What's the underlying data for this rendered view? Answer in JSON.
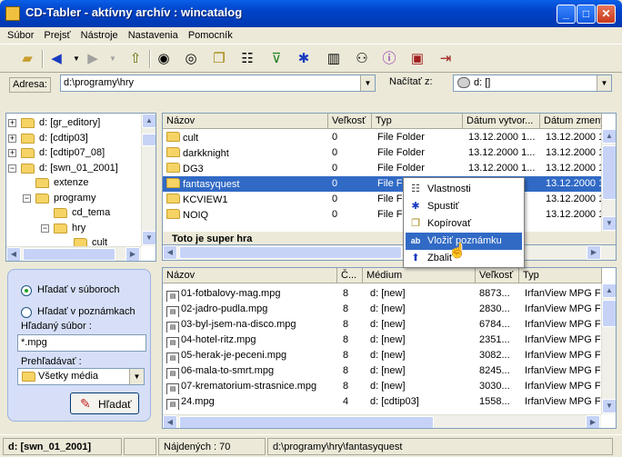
{
  "window": {
    "title": "CD-Tabler  - aktívny archív  : wincatalog",
    "minimize": "_",
    "maximize": "□",
    "close": "✕"
  },
  "menu": [
    "Súbor",
    "Prejsť",
    "Nástroje",
    "Nastavenia",
    "Pomocník"
  ],
  "toolbar_icons": [
    "open-folder-icon",
    "back-icon",
    "dropdown-icon",
    "forward-icon",
    "dropdown-icon",
    "up-folder-icon",
    "binoculars-icon",
    "binoculars-multi-icon",
    "copy-icon",
    "properties-icon",
    "filter-icon",
    "run-icon",
    "delete-icon",
    "network-icon",
    "info-icon",
    "book-icon",
    "exit-icon"
  ],
  "address": {
    "label": "Adresa:",
    "value": "d:\\programy\\hry",
    "load_label": "Načítať z:",
    "load_value": "d: []"
  },
  "tree": {
    "items": [
      {
        "label": "d: [gr_editory]",
        "level": 0,
        "exp": "+"
      },
      {
        "label": "d: [cdtip03]",
        "level": 0,
        "exp": "+"
      },
      {
        "label": "d: [cdtip07_08]",
        "level": 0,
        "exp": "+"
      },
      {
        "label": "d: [swn_01_2001]",
        "level": 0,
        "exp": "-"
      },
      {
        "label": "extenze",
        "level": 1,
        "exp": ""
      },
      {
        "label": "programy",
        "level": 1,
        "exp": "-"
      },
      {
        "label": "cd_tema",
        "level": 2,
        "exp": ""
      },
      {
        "label": "hry",
        "level": 2,
        "exp": "-"
      },
      {
        "label": "cult",
        "level": 3,
        "exp": ""
      }
    ]
  },
  "folders": {
    "headers": [
      "Názov",
      "Veľkosť",
      "Typ",
      "Dátum vytvor...",
      "Dátum zmeny"
    ],
    "rows": [
      {
        "name": "cult",
        "size": "0",
        "type": "File Folder",
        "created": "13.12.2000 1...",
        "modified": "13.12.2000 1...",
        "selected": false
      },
      {
        "name": "darkknight",
        "size": "0",
        "type": "File Folder",
        "created": "13.12.2000 1...",
        "modified": "13.12.2000 1...",
        "selected": false
      },
      {
        "name": "DG3",
        "size": "0",
        "type": "File Folder",
        "created": "13.12.2000 1...",
        "modified": "13.12.2000 1...",
        "selected": false
      },
      {
        "name": "fantasyquest",
        "size": "0",
        "type": "File Fo",
        "created": "",
        "modified": "13.12.2000 1...",
        "selected": true
      },
      {
        "name": "KCVIEW1",
        "size": "0",
        "type": "File Fo",
        "created": "",
        "modified": "13.12.2000 1...",
        "selected": false
      },
      {
        "name": "NOIQ",
        "size": "0",
        "type": "File Fo",
        "created": "",
        "modified": "13.12.2000 1...",
        "selected": false
      }
    ],
    "note": "Toto je super hra"
  },
  "context_menu": [
    {
      "label": "Vlastnosti",
      "icon": "properties-icon"
    },
    {
      "label": "Spustiť",
      "icon": "run-icon"
    },
    {
      "label": "Kopírovať",
      "icon": "copy-icon"
    },
    {
      "label": "Vložiť poznámku",
      "icon": "note-icon"
    },
    {
      "label": "Zbaliť",
      "icon": "collapse-up-icon"
    }
  ],
  "search": {
    "radio_files": "Hľadať v súboroch",
    "radio_notes": "Hľadať v poznámkach",
    "file_label": "Hľadaný súbor :",
    "file_value": "*.mpg",
    "browse_label": "Prehľadávať :",
    "browse_value": "Všetky média",
    "search_button": "Hľadať"
  },
  "results": {
    "headers": [
      "Názov",
      "Č...",
      "Médium",
      "Veľkosť",
      "Typ"
    ],
    "rows": [
      {
        "name": "01-fotbalovy-mag.mpg",
        "num": "8",
        "medium": "d: [new]",
        "size": "8873...",
        "type": "IrfanView MPG File"
      },
      {
        "name": "02-jadro-pudla.mpg",
        "num": "8",
        "medium": "d: [new]",
        "size": "2830...",
        "type": "IrfanView MPG File"
      },
      {
        "name": "03-byl-jsem-na-disco.mpg",
        "num": "8",
        "medium": "d: [new]",
        "size": "6784...",
        "type": "IrfanView MPG File"
      },
      {
        "name": "04-hotel-ritz.mpg",
        "num": "8",
        "medium": "d: [new]",
        "size": "2351...",
        "type": "IrfanView MPG File"
      },
      {
        "name": "05-herak-je-peceni.mpg",
        "num": "8",
        "medium": "d: [new]",
        "size": "3082...",
        "type": "IrfanView MPG File"
      },
      {
        "name": "06-mala-to-smrt.mpg",
        "num": "8",
        "medium": "d: [new]",
        "size": "8245...",
        "type": "IrfanView MPG File"
      },
      {
        "name": "07-krematorium-strasnice.mpg",
        "num": "8",
        "medium": "d: [new]",
        "size": "3030...",
        "type": "IrfanView MPG File"
      },
      {
        "name": "24.mpg",
        "num": "4",
        "medium": "d: [cdtip03]",
        "size": "1558...",
        "type": "IrfanView MPG File"
      }
    ]
  },
  "status": {
    "drive": "d: [swn_01_2001]",
    "found": "Nájdených : 70",
    "path": "d:\\programy\\hry\\fantasyquest"
  }
}
